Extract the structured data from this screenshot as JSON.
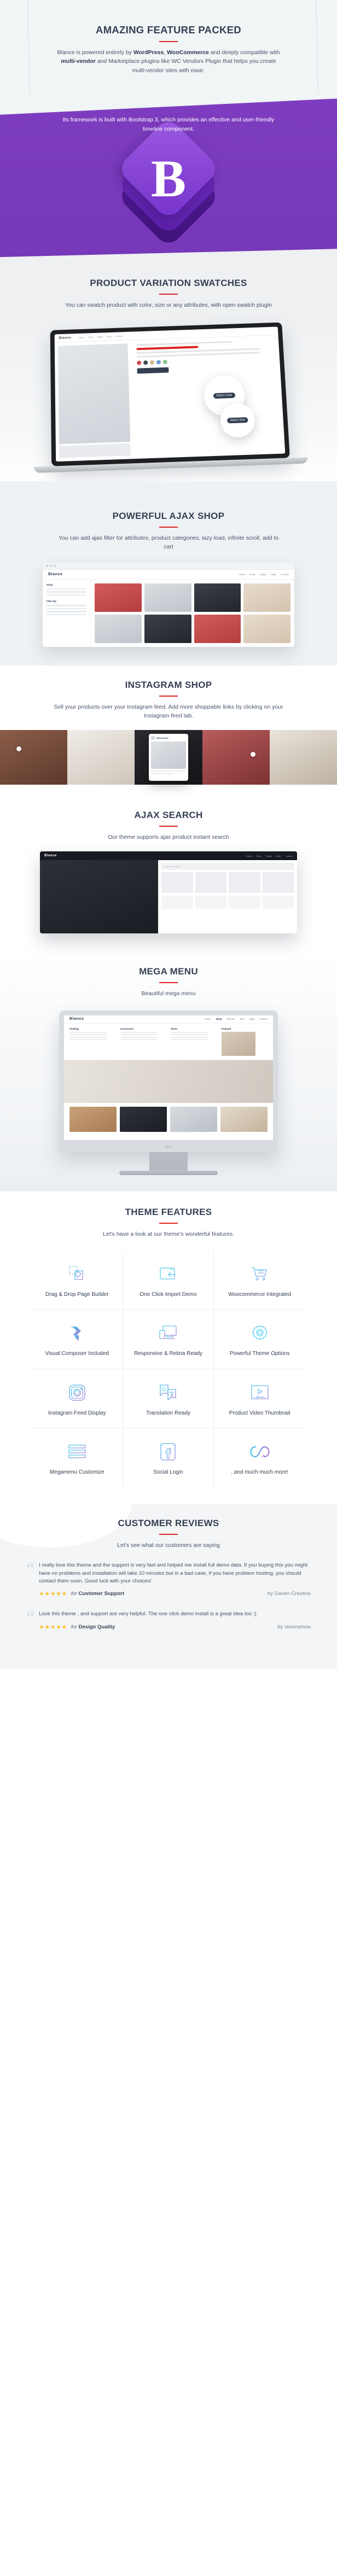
{
  "hero": {
    "title": "AMAZING FEATURE PACKED",
    "desc_pre": "Blance is powered entirely by ",
    "desc_b1": "WordPress",
    "desc_mid1": ", ",
    "desc_b2": "WooCommerce",
    "desc_mid2": " and deeply compatible with ",
    "desc_b3": "multi-vendor",
    "desc_end": " and Marketplace plugins like WC Vendors Plugin that helps you create multi-vendor sites with ease."
  },
  "bootstrap": {
    "text": "Its framework is built with Bootstrap 3, which provides an effective and user-friendly timeline component.",
    "logo_letter": "B",
    "bg_color": "#7b39bd"
  },
  "swatches": {
    "title": "PRODUCT VARIATION SWATCHES",
    "desc": "You can swatch product with color, size or any attributes, with open swatch plugin",
    "shop_logo": "Blance",
    "nav": [
      "Home",
      "Shop",
      "Pages",
      "Blog",
      "Contact"
    ],
    "callout_color": "Select Color",
    "callout_size": "Select Size",
    "swatch_colors": [
      "#d24b4b",
      "#3e4654",
      "#d9b98a",
      "#6e9bd1",
      "#8bc18b"
    ]
  },
  "ajax_shop": {
    "title": "POWERFUL AJAX SHOP",
    "desc": "You can add ajax filter for attributes, product categories, lazy load, infinite scroll, add to cart",
    "shop_logo": "Blance",
    "nav": [
      "Home",
      "Shop",
      "Pages",
      "Blog",
      "Contact"
    ],
    "sidebar_title": "Shop",
    "filter_title": "Filter By"
  },
  "instagram": {
    "title": "INSTAGRAM SHOP",
    "desc": "Sell your products over your Instagram feed. Add more shoppable links by clicking on your Instagram feed tab.",
    "card_name": "blancetheme"
  },
  "ajax_search": {
    "title": "AJAX SEARCH",
    "desc": "Our theme supports ajax product instant search",
    "shop_logo": "Blance",
    "nav": [
      "Home",
      "Shop",
      "Pages",
      "Blog",
      "Contact"
    ],
    "search_placeholder": "Search products..."
  },
  "mega_menu": {
    "title": "MEGA MENU",
    "desc": "Beautiful mega menu",
    "shop_logo": "Blance",
    "nav": [
      "Home",
      "Shop",
      "Women",
      "Men",
      "Blog",
      "Contact"
    ],
    "columns": [
      {
        "heading": "Clothing"
      },
      {
        "heading": "Accessories"
      },
      {
        "heading": "Shoes"
      },
      {
        "heading": "Featured"
      }
    ],
    "imac_brand": "iMac"
  },
  "features": {
    "title": "THEME FEATURES",
    "desc": "Let's have a look at our theme's wonderful features.",
    "items": [
      {
        "label": "Drag & Drop Page Builder",
        "icon": "drag-drop-icon"
      },
      {
        "label": "One Click Import Demo",
        "icon": "import-demo-icon"
      },
      {
        "label": "Woocommerce Integrated",
        "icon": "shopping-cart-icon"
      },
      {
        "label": "Visual Composer Included",
        "icon": "visual-composer-icon"
      },
      {
        "label": "Responsive & Retina Ready",
        "icon": "responsive-devices-icon"
      },
      {
        "label": "Powerful Theme Options",
        "icon": "gear-icon"
      },
      {
        "label": "Instagram Feed Display",
        "icon": "instagram-icon"
      },
      {
        "label": "Translation Ready",
        "icon": "translate-icon"
      },
      {
        "label": "Product Video Thumbnail",
        "icon": "video-player-icon"
      },
      {
        "label": "Megamenu Customize",
        "icon": "menu-lines-icon"
      },
      {
        "label": "Social Login",
        "icon": "facebook-icon"
      },
      {
        "label": "..and much much more!",
        "icon": "infinity-icon"
      }
    ]
  },
  "reviews": {
    "title": "CUSTOMER REVIEWS",
    "desc": "Let's see what our customers are saying",
    "items": [
      {
        "text": "I really love this theme and the support is very fast and helped me install full demo data. If you buying this you might have no problems and installation will take 10 minutes but in a bad case, if you have problem hosting, you should contact them soon. Good luck with your choices!",
        "stars": "★★★★★",
        "for_label": "for",
        "category": "Customer Support",
        "author": "by Gaven-Creative"
      },
      {
        "text": "Love this theme , and support are very helpful. The one click demo install is a great idea too :)",
        "stars": "★★★★★",
        "for_label": "for",
        "category": "Design Quality",
        "author": "by simonehow"
      }
    ]
  }
}
